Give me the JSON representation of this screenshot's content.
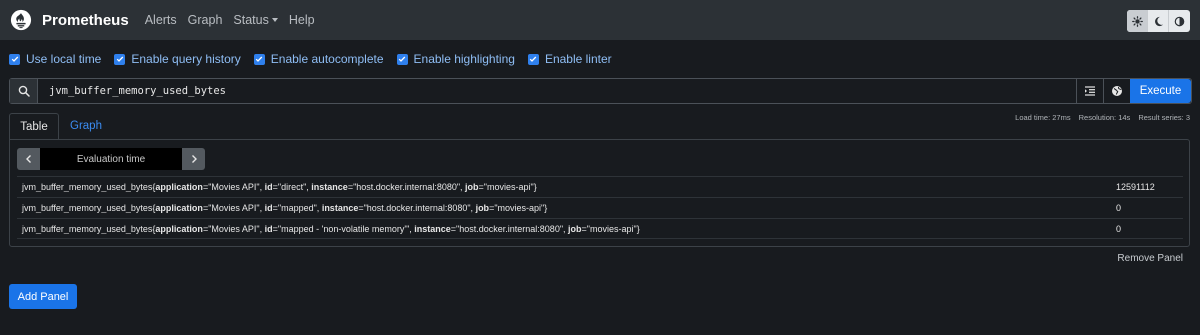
{
  "navbar": {
    "brand": "Prometheus",
    "links": [
      "Alerts",
      "Graph",
      "Status",
      "Help"
    ],
    "theme_icons": [
      "sun-gear-icon",
      "moon-icon",
      "half-circle-icon"
    ]
  },
  "options": [
    {
      "label": "Use local time",
      "checked": true
    },
    {
      "label": "Enable query history",
      "checked": true
    },
    {
      "label": "Enable autocomplete",
      "checked": true
    },
    {
      "label": "Enable highlighting",
      "checked": true
    },
    {
      "label": "Enable linter",
      "checked": true
    }
  ],
  "query": {
    "value": "jvm_buffer_memory_used_bytes",
    "execute_label": "Execute"
  },
  "tabs": {
    "table": "Table",
    "graph": "Graph"
  },
  "stats": {
    "load_time": "Load time: 27ms",
    "resolution": "Resolution: 14s",
    "result_series": "Result series: 3"
  },
  "eval": {
    "placeholder": "Evaluation time"
  },
  "results": [
    {
      "metric": "jvm_buffer_memory_used_bytes",
      "labels": [
        {
          "key": "application",
          "value": "Movies API"
        },
        {
          "key": "id",
          "value": "direct"
        },
        {
          "key": "instance",
          "value": "host.docker.internal:8080"
        },
        {
          "key": "job",
          "value": "movies-api"
        }
      ],
      "value": "12591112"
    },
    {
      "metric": "jvm_buffer_memory_used_bytes",
      "labels": [
        {
          "key": "application",
          "value": "Movies API"
        },
        {
          "key": "id",
          "value": "mapped"
        },
        {
          "key": "instance",
          "value": "host.docker.internal:8080"
        },
        {
          "key": "job",
          "value": "movies-api"
        }
      ],
      "value": "0"
    },
    {
      "metric": "jvm_buffer_memory_used_bytes",
      "labels": [
        {
          "key": "application",
          "value": "Movies API"
        },
        {
          "key": "id",
          "value": "mapped - 'non-volatile memory'"
        },
        {
          "key": "instance",
          "value": "host.docker.internal:8080"
        },
        {
          "key": "job",
          "value": "movies-api"
        }
      ],
      "value": "0"
    }
  ],
  "remove_panel": "Remove Panel",
  "add_panel": "Add Panel",
  "colors": {
    "accent": "#1a74e8",
    "link": "#3b8cf1",
    "navbar": "#2c3136",
    "background": "#181b1f"
  }
}
